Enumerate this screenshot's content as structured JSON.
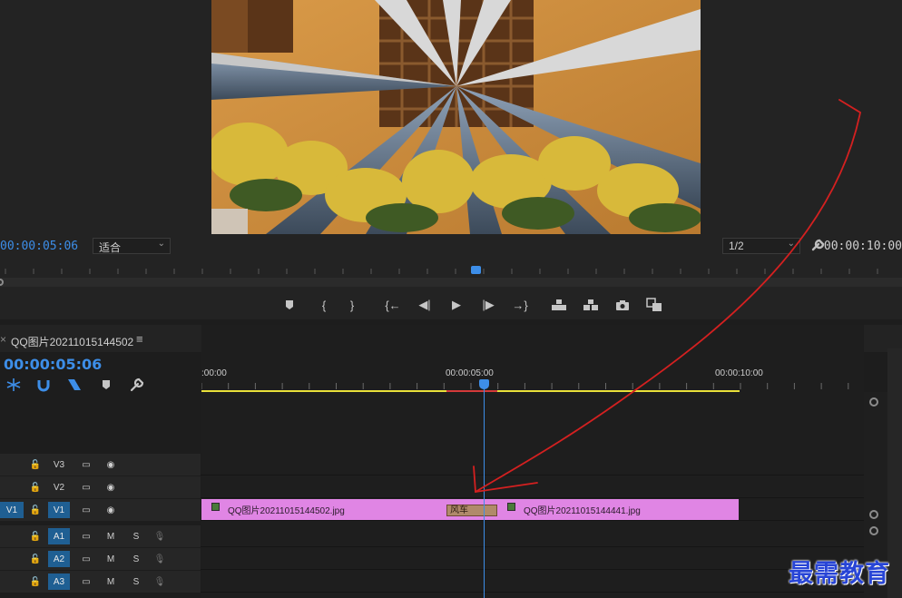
{
  "monitor": {
    "current_timecode": "00:00:05:06",
    "duration_timecode": "00:00:10:00",
    "zoom_value": "适合",
    "resolution_value": "1/2",
    "playhead_fraction": 0.527
  },
  "transport": {
    "marker_icon": "marker-icon",
    "in_icon": "mark-in-icon",
    "out_icon": "mark-out-icon",
    "goto_in_icon": "go-to-in-icon",
    "step_back_icon": "step-back-icon",
    "play_icon": "play-icon",
    "step_forward_icon": "step-forward-icon",
    "goto_out_icon": "go-to-out-icon",
    "lift_icon": "lift-icon",
    "extract_icon": "extract-icon",
    "export_frame_icon": "camera-icon",
    "compare_icon": "compare-icon"
  },
  "timeline": {
    "sequence_name": "QQ图片20211015144502",
    "menu_icon": "≡",
    "timecode": "00:00:05:06",
    "ruler_labels": [
      ":00:00",
      "00:00:05:00",
      "00:00:10:00"
    ],
    "tracks": [
      {
        "id": "V3",
        "type": "video",
        "target": "",
        "label": "V3"
      },
      {
        "id": "V2",
        "type": "video",
        "target": "",
        "label": "V2"
      },
      {
        "id": "V1",
        "type": "video",
        "target": "V1",
        "label": "V1"
      },
      {
        "id": "A1",
        "type": "audio",
        "target": "",
        "label": "A1",
        "mute": "M",
        "solo": "S"
      },
      {
        "id": "A2",
        "type": "audio",
        "target": "",
        "label": "A2",
        "mute": "M",
        "solo": "S"
      },
      {
        "id": "A3",
        "type": "audio",
        "target": "",
        "label": "A3",
        "mute": "M",
        "solo": "S"
      }
    ],
    "clips": [
      {
        "track": "V1",
        "name": "QQ图片20211015144502.jpg"
      },
      {
        "track": "V1",
        "name": "QQ图片20211015144441.jpg"
      }
    ],
    "transition_label": "风车"
  },
  "colors": {
    "accent_blue": "#3d8ee8",
    "clip_pink": "#e085e4",
    "annotation_red": "#d42020",
    "watermark_blue": "#2845d6"
  },
  "watermark": "最需教育"
}
